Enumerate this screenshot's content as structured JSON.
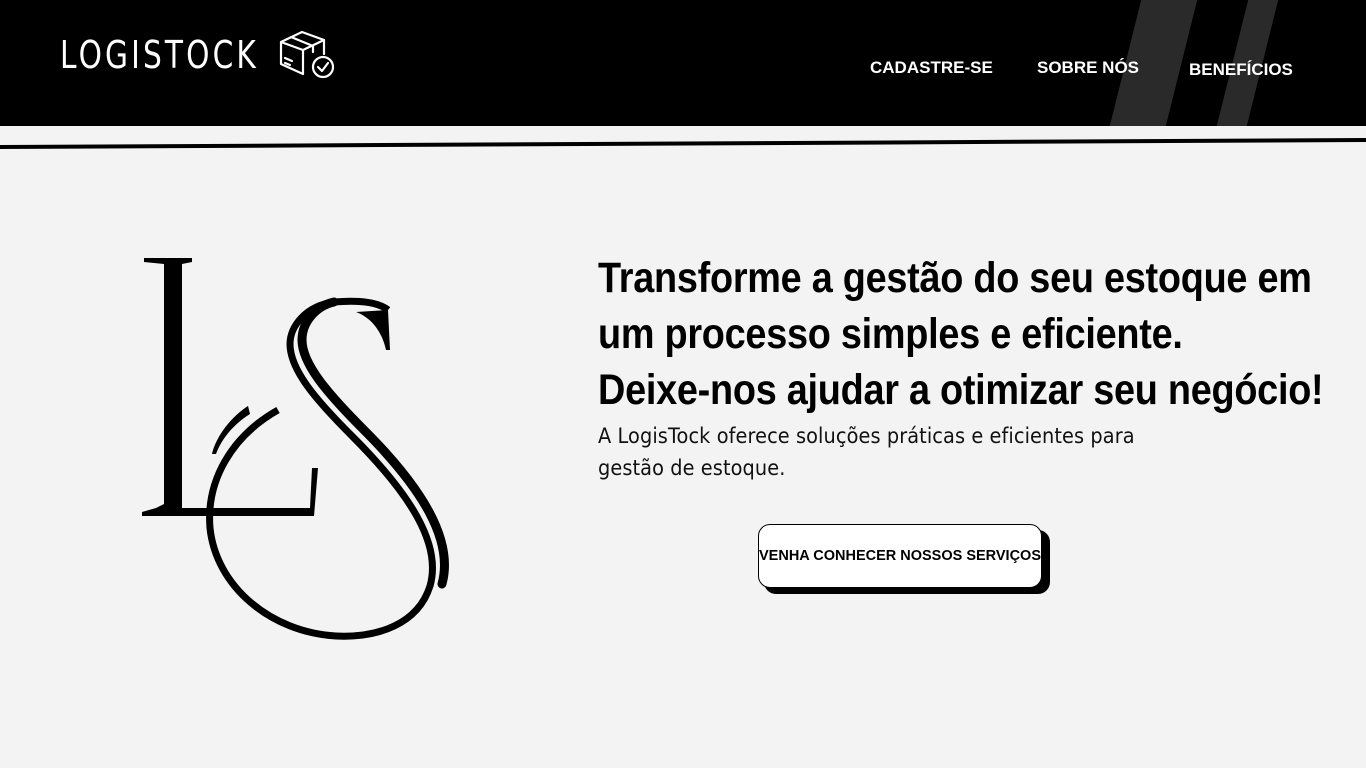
{
  "header": {
    "brand": "LOGISTOCK",
    "brand_icon": "package-check-icon",
    "nav": [
      {
        "label": "CADASTRE-SE"
      },
      {
        "label": "SOBRE NÓS"
      },
      {
        "label": "BENEFÍCIOS"
      }
    ],
    "colors": {
      "background": "#000000",
      "text": "#ffffff",
      "stripe": "#2a2a2a"
    }
  },
  "hero": {
    "logo_icon": "ls-monogram-logo",
    "headline": [
      "Transforme a gestão do seu estoque em",
      "um processo simples e eficiente.",
      "Deixe-nos ajudar a otimizar seu negócio!"
    ],
    "subtext": "A LogisTock oferece soluções práticas e eficientes para gestão de estoque.",
    "cta_label": "VENHA CONHECER NOSSOS SERVIÇOS"
  },
  "colors": {
    "page_background": "#f3f3f3",
    "accent": "#000000"
  }
}
